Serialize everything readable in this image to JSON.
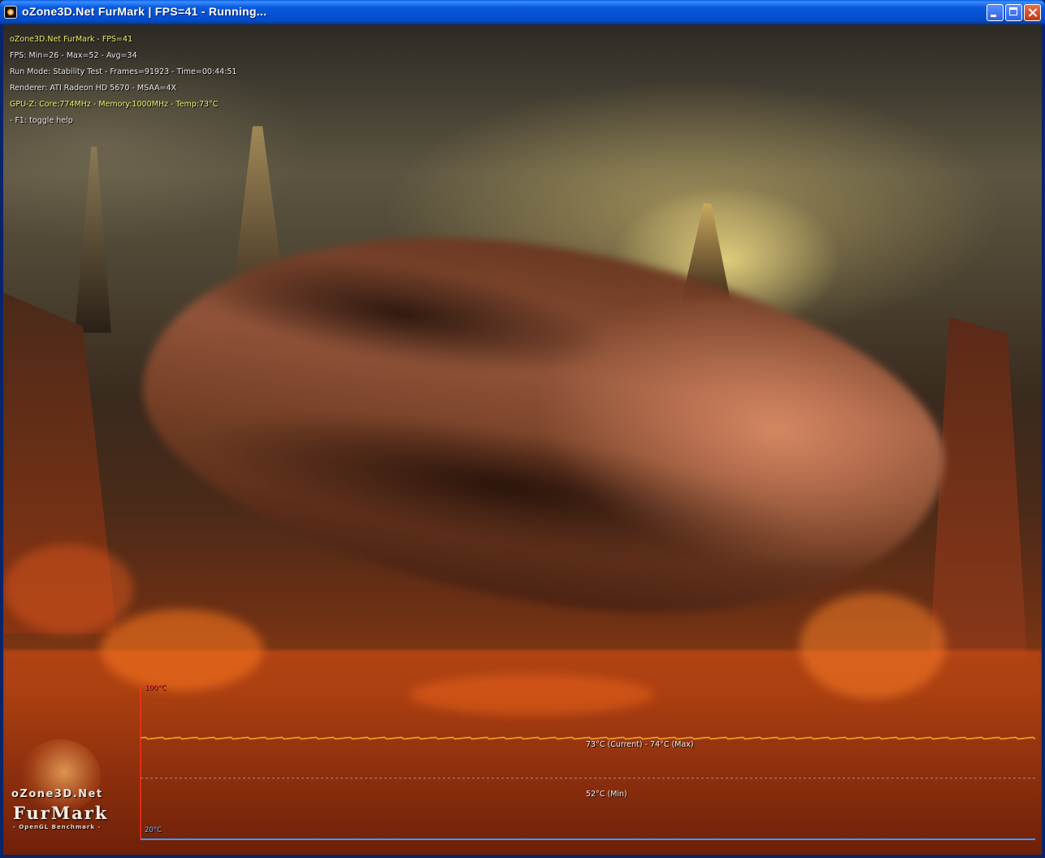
{
  "window": {
    "title": "oZone3D.Net FurMark  |  FPS=41 - Running...",
    "app_icon": "furmark-app-icon",
    "controls": [
      "minimize-icon",
      "maximize-icon",
      "close-icon"
    ]
  },
  "hud": {
    "title": "oZone3D.Net FurMark - FPS=41",
    "fps": "FPS: Min=26 - Max=52 - Avg=34",
    "run_mode": "Run Mode: Stability Test - Frames=91923 - Time=00:44:51",
    "renderer": "Renderer: ATI Radeon HD 5670 - MSAA=4X",
    "gpuz": "GPU-Z: Core:774MHz - Memory:1000MHz - Temp:73°C",
    "help": "- F1: toggle help"
  },
  "temperature_graph": {
    "current_label": "73°C (Current) - 74°C (Max)",
    "min_label": "52°C (Min)",
    "axis_min_label": "20°C",
    "axis_max_label": "100°C",
    "current_temp": 73,
    "max_temp": 74,
    "min_temp": 52,
    "axis_min": 20,
    "axis_max": 100,
    "line_color": "#f5a623",
    "axis_color": "#ff2a1a",
    "baseline_color": "#3a9cff"
  },
  "logo": {
    "top": "oZone3D.Net",
    "main": "FurMark",
    "sub": "- OpenGL Benchmark -"
  }
}
